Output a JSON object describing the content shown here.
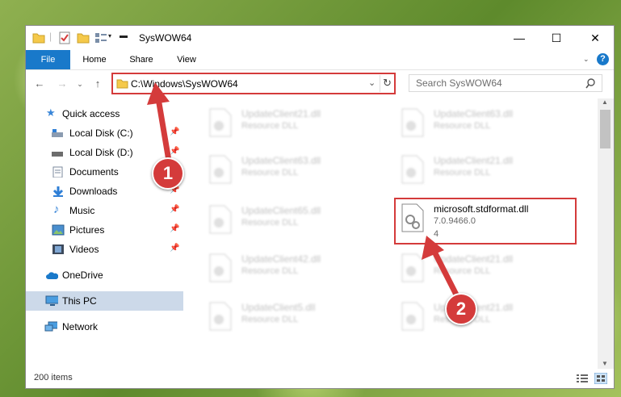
{
  "window": {
    "title": "SysWOW64",
    "minimize": "—",
    "maximize": "☐",
    "close": "✕"
  },
  "ribbon": {
    "tabs": [
      "File",
      "Home",
      "Share",
      "View"
    ],
    "help": "?"
  },
  "address": {
    "path": "C:\\Windows\\SysWOW64",
    "search_placeholder": "Search SysWOW64"
  },
  "nav": {
    "items": [
      {
        "label": "Quick access",
        "icon": "star-icon"
      },
      {
        "label": "Local Disk (C:)",
        "icon": "drive-icon",
        "pinned": true
      },
      {
        "label": "Local Disk (D:)",
        "icon": "drive-icon",
        "pinned": true
      },
      {
        "label": "Documents",
        "icon": "documents-icon",
        "pinned": true
      },
      {
        "label": "Downloads",
        "icon": "downloads-icon",
        "pinned": true
      },
      {
        "label": "Music",
        "icon": "music-icon",
        "pinned": true
      },
      {
        "label": "Pictures",
        "icon": "pictures-icon",
        "pinned": true
      },
      {
        "label": "Videos",
        "icon": "videos-icon",
        "pinned": true
      },
      {
        "label": "OneDrive",
        "icon": "cloud-icon"
      },
      {
        "label": "This PC",
        "icon": "computer-icon",
        "selected": true
      },
      {
        "label": "Network",
        "icon": "network-icon"
      }
    ]
  },
  "files": [
    {
      "name": "UpdateClient21.dll",
      "type": "Resource DLL"
    },
    {
      "name": "UpdateClient63.dll",
      "type": "Resource DLL"
    },
    {
      "name": "UpdateClient63.dll",
      "type": "Resource DLL"
    },
    {
      "name": "UpdateClient21.dll",
      "type": "Resource DLL"
    },
    {
      "name": "UpdateClient65.dll",
      "type": "Resource DLL"
    },
    {
      "name": "microsoft.stdformat.dll",
      "type": "7.0.9466.0",
      "size": "4"
    },
    {
      "name": "UpdateClient42.dll",
      "type": "Resource DLL"
    },
    {
      "name": "UpdateClient21.dll",
      "type": "Resource DLL"
    },
    {
      "name": "UpdateClient5.dll",
      "type": "Resource DLL"
    },
    {
      "name": "UpdateClient21.dll",
      "type": "Resource DLL"
    }
  ],
  "status": {
    "count": "200 items"
  },
  "annotations": {
    "badge1": "1",
    "badge2": "2"
  },
  "colors": {
    "accent": "#1979ca",
    "highlight": "#d43b3b",
    "selected": "#ccd9e9"
  }
}
